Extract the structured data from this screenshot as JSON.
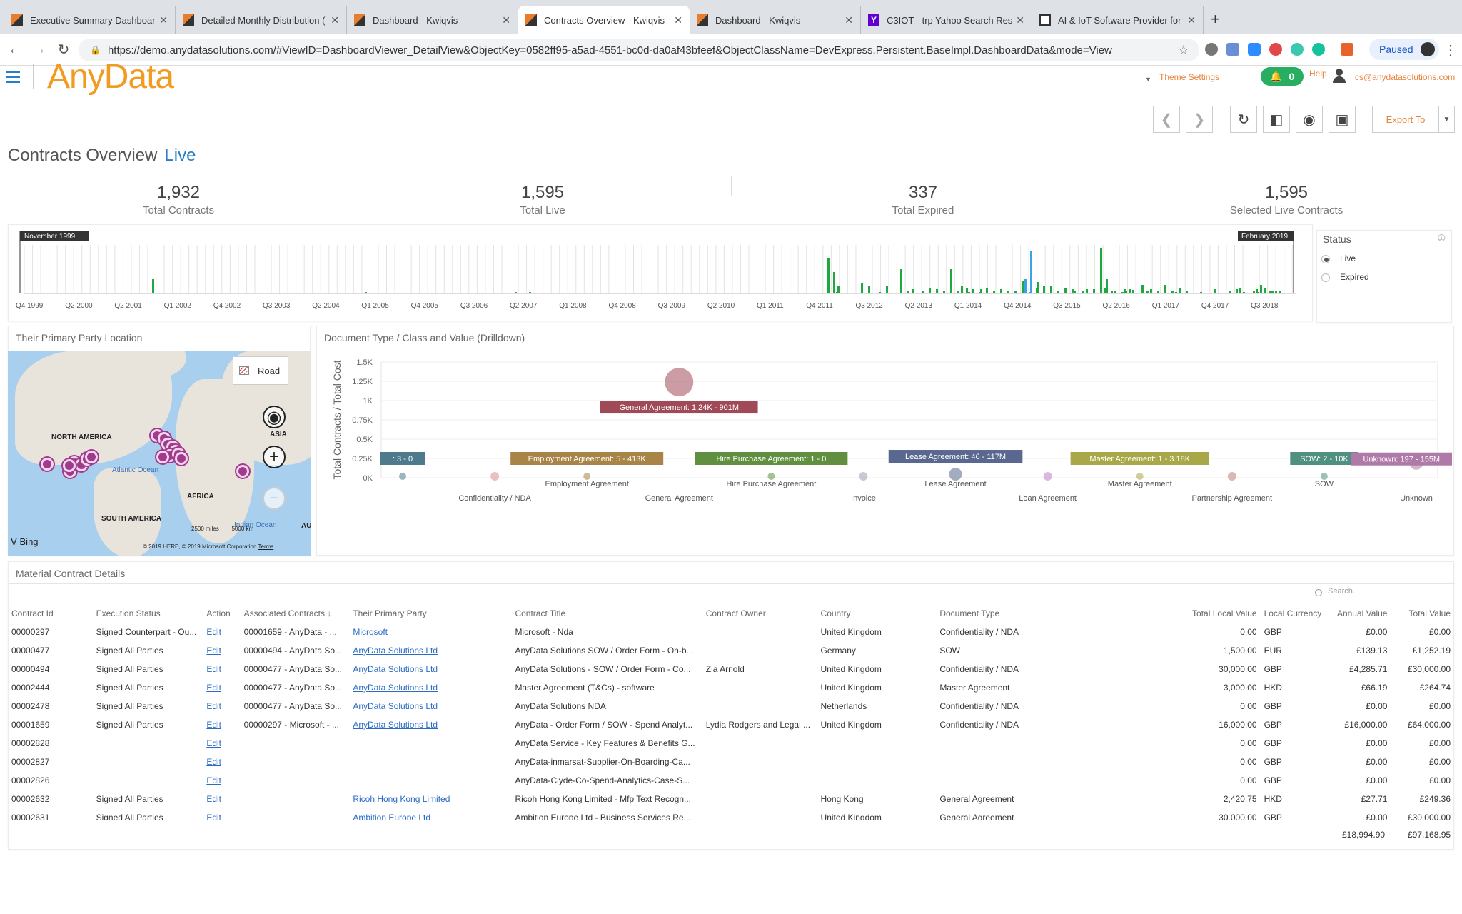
{
  "browser": {
    "tabs": [
      {
        "title": "Executive Summary Dashboard",
        "icon": "anydata-favicon"
      },
      {
        "title": "Detailed Monthly Distribution (",
        "icon": "anydata-favicon"
      },
      {
        "title": "Dashboard - Kwiqvis",
        "icon": "anydata-favicon"
      },
      {
        "title": "Contracts Overview - Kwiqvis",
        "icon": "anydata-favicon",
        "active": true
      },
      {
        "title": "Dashboard - Kwiqvis",
        "icon": "anydata-favicon"
      },
      {
        "title": "C3IOT - trp Yahoo Search Resu",
        "icon": "yahoo-favicon"
      },
      {
        "title": "AI & IoT Software Provider for",
        "icon": "document-favicon"
      }
    ],
    "url": "https://demo.anydatasolutions.com/#ViewID=DashboardViewer_DetailView&ObjectKey=0582ff95-a5ad-4551-bc0d-da0af43bfeef&ObjectClassName=DevExpress.Persistent.BaseImpl.DashboardData&mode=View",
    "profile_status": "Paused"
  },
  "app": {
    "logo": "AnyData",
    "theme_settings": "Theme Settings",
    "notifications": "0",
    "help": "Help",
    "user_email": "cs@anydatasolutions.com",
    "export_label": "Export To"
  },
  "page": {
    "title": "Contracts Overview",
    "mode": "Live"
  },
  "kpis": [
    {
      "value": "1,932",
      "label": "Total Contracts"
    },
    {
      "value": "1,595",
      "label": "Total Live"
    },
    {
      "value": "337",
      "label": "Total Expired"
    },
    {
      "value": "1,595",
      "label": "Selected Live Contracts"
    }
  ],
  "timeline": {
    "start_label": "November 1999",
    "end_label": "February 2019",
    "ticks": [
      "Q4 1999",
      "Q2 2000",
      "Q2 2001",
      "Q1 2002",
      "Q4 2002",
      "Q3 2003",
      "Q2 2004",
      "Q1 2005",
      "Q4 2005",
      "Q3 2006",
      "Q2 2007",
      "Q1 2008",
      "Q4 2008",
      "Q3 2009",
      "Q2 2010",
      "Q1 2011",
      "Q4 2011",
      "Q3 2012",
      "Q2 2013",
      "Q1 2014",
      "Q4 2014",
      "Q3 2015",
      "Q2 2016",
      "Q1 2017",
      "Q4 2017",
      "Q3 2018"
    ]
  },
  "status_filter": {
    "title": "Status",
    "options": [
      {
        "label": "Live",
        "selected": true
      },
      {
        "label": "Expired",
        "selected": false
      }
    ]
  },
  "map": {
    "title": "Their Primary Party Location",
    "road_label": "Road",
    "labels": {
      "north_america": "NORTH AMERICA",
      "south_america": "SOUTH AMERICA",
      "africa": "AFRICA",
      "asia": "ASIA",
      "atlantic": "Atlantic Ocean",
      "indian": "Indian Ocean",
      "australia_abbr": "AU"
    },
    "provider": "Bing",
    "copyright": "© 2019 HERE, © 2019 Microsoft Corporation",
    "terms": "Terms",
    "scale_miles": "2500 miles",
    "scale_km": "5000 km"
  },
  "chart_data": {
    "type": "scatter",
    "title": "Document Type / Class and Value (Drilldown)",
    "ylabel": "Total Contracts / Total Cost",
    "ylim": [
      0,
      1500
    ],
    "y_ticks": [
      "0K",
      "0.25K",
      "0.5K",
      "0.75K",
      "1K",
      "1.25K",
      "1.5K"
    ],
    "categories": [
      "",
      "Confidentiality / NDA",
      "Employment Agreement",
      "General Agreement",
      "Hire Purchase Agreement",
      "Invoice",
      "Lease Agreement",
      "Loan Agreement",
      "Master Agreement",
      "Partnership Agreement",
      "SOW",
      "Unknown"
    ],
    "points": [
      {
        "category": "",
        "count": 3,
        "label": ": 3 - 0",
        "color": "#4f7a8b"
      },
      {
        "category": "Confidentiality / NDA",
        "count": 0,
        "label": "",
        "color": "#d98c8c"
      },
      {
        "category": "Employment Agreement",
        "count": 5,
        "label": "Employment Agreement: 5 - 413K",
        "color": "#a88446"
      },
      {
        "category": "General Agreement",
        "count": 1240,
        "label": "General Agreement: 1.24K - 901M",
        "color": "#a04a58"
      },
      {
        "category": "Hire Purchase Agreement",
        "count": 1,
        "label": "Hire Purchase Agreement: 1 - 0",
        "color": "#5f8f3f"
      },
      {
        "category": "Invoice",
        "count": 0,
        "label": "",
        "color": "#9aa0b0"
      },
      {
        "category": "Lease Agreement",
        "count": 46,
        "label": "Lease Agreement: 46 - 117M",
        "color": "#5a6890"
      },
      {
        "category": "Loan Agreement",
        "count": 0,
        "label": "",
        "color": "#c080c0"
      },
      {
        "category": "Master Agreement",
        "count": 1,
        "label": "Master Agreement: 1 - 3.18K",
        "color": "#a8a848"
      },
      {
        "category": "Partnership Agreement",
        "count": 0,
        "label": "",
        "color": "#c08080"
      },
      {
        "category": "SOW",
        "count": 2,
        "label": "SOW: 2 - 10K",
        "color": "#4f9080"
      },
      {
        "category": "Unknown",
        "count": 197,
        "label": "Unknown: 197 - 155M",
        "color": "#b07aa8"
      }
    ]
  },
  "table": {
    "title": "Material Contract Details",
    "search_placeholder": "Search...",
    "columns": [
      "Contract Id",
      "Execution Status",
      "Action",
      "Associated Contracts",
      "Their Primary Party",
      "Contract Title",
      "Contract Owner",
      "Country",
      "Document Type",
      "Total Local Value",
      "Local Currency",
      "Annual Value",
      "Total Value"
    ],
    "rows": [
      [
        "00000297",
        "Signed Counterpart - Ou...",
        "Edit",
        "00001659 - AnyData - ...",
        "Microsoft",
        "Microsoft - Nda",
        "",
        "United Kingdom",
        "Confidentiality / NDA",
        "0.00",
        "GBP",
        "£0.00",
        "£0.00"
      ],
      [
        "00000477",
        "Signed All Parties",
        "Edit",
        "00000494 - AnyData So...",
        "AnyData Solutions Ltd",
        "AnyData Solutions SOW / Order Form - On-b...",
        "",
        "Germany",
        "SOW",
        "1,500.00",
        "EUR",
        "£139.13",
        "£1,252.19"
      ],
      [
        "00000494",
        "Signed All Parties",
        "Edit",
        "00000477 - AnyData So...",
        "AnyData Solutions Ltd",
        "AnyData Solutions - SOW / Order Form - Co...",
        "Zia Arnold",
        "United Kingdom",
        "Confidentiality / NDA",
        "30,000.00",
        "GBP",
        "£4,285.71",
        "£30,000.00"
      ],
      [
        "00002444",
        "Signed All Parties",
        "Edit",
        "00000477 - AnyData So...",
        "AnyData Solutions Ltd",
        "Master Agreement (T&Cs) - software",
        "",
        "United Kingdom",
        "Master Agreement",
        "3,000.00",
        "HKD",
        "£66.19",
        "£264.74"
      ],
      [
        "00002478",
        "Signed All Parties",
        "Edit",
        "00000477 - AnyData So...",
        "AnyData Solutions Ltd",
        "AnyData Solutions NDA",
        "",
        "Netherlands",
        "Confidentiality / NDA",
        "0.00",
        "GBP",
        "£0.00",
        "£0.00"
      ],
      [
        "00001659",
        "Signed All Parties",
        "Edit",
        "00000297 - Microsoft - ...",
        "AnyData Solutions Ltd",
        "AnyData - Order Form / SOW - Spend Analyt...",
        "Lydia Rodgers and Legal ...",
        "United Kingdom",
        "Confidentiality / NDA",
        "16,000.00",
        "GBP",
        "£16,000.00",
        "£64,000.00"
      ],
      [
        "00002828",
        "",
        "Edit",
        "",
        "",
        "AnyData Service - Key Features & Benefits G...",
        "",
        "",
        "",
        "0.00",
        "GBP",
        "£0.00",
        "£0.00"
      ],
      [
        "00002827",
        "",
        "Edit",
        "",
        "",
        "AnyData-inmarsat-Supplier-On-Boarding-Ca...",
        "",
        "",
        "",
        "0.00",
        "GBP",
        "£0.00",
        "£0.00"
      ],
      [
        "00002826",
        "",
        "Edit",
        "",
        "",
        "AnyData-Clyde-Co-Spend-Analytics-Case-S...",
        "",
        "",
        "",
        "0.00",
        "GBP",
        "£0.00",
        "£0.00"
      ],
      [
        "00002632",
        "Signed All Parties",
        "Edit",
        "",
        "Ricoh Hong Kong Limited",
        "Ricoh Hong Kong Limited - Mfp Text Recogn...",
        "",
        "Hong Kong",
        "General Agreement",
        "2,420.75",
        "HKD",
        "£27.71",
        "£249.36"
      ],
      [
        "00002631",
        "Signed All Parties",
        "Edit",
        "",
        "Ambition Europe Ltd",
        "Ambition Europe Ltd - Business Services Re...",
        "",
        "United Kingdom",
        "General Agreement",
        "30,000.00",
        "GBP",
        "£0.00",
        "£30,000.00"
      ]
    ],
    "totals": {
      "annual": "£18,994.90",
      "total": "£97,168.95"
    }
  }
}
